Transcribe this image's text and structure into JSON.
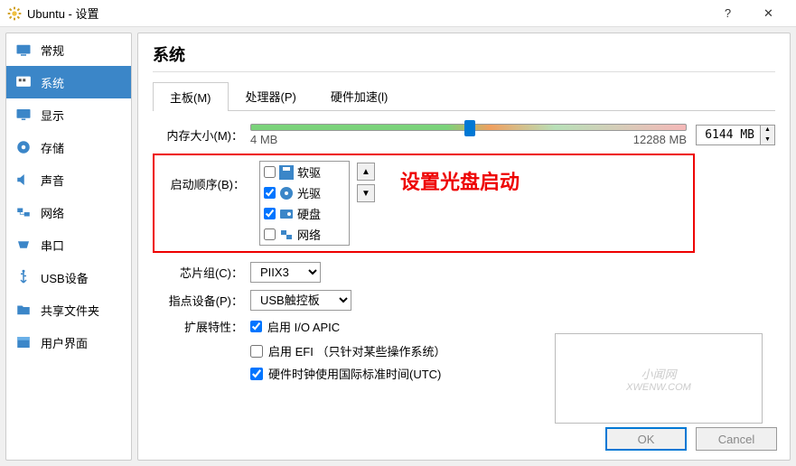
{
  "window": {
    "title": "Ubuntu - 设置",
    "help": "?",
    "close": "✕"
  },
  "sidebar": {
    "items": [
      {
        "label": "常规"
      },
      {
        "label": "系统"
      },
      {
        "label": "显示"
      },
      {
        "label": "存储"
      },
      {
        "label": "声音"
      },
      {
        "label": "网络"
      },
      {
        "label": "串口"
      },
      {
        "label": "USB设备"
      },
      {
        "label": "共享文件夹"
      },
      {
        "label": "用户界面"
      }
    ],
    "selected_index": 1
  },
  "page": {
    "title": "系统"
  },
  "tabs": {
    "items": [
      "主板(M)",
      "处理器(P)",
      "硬件加速(l)"
    ],
    "active_index": 0
  },
  "memory": {
    "label": "内存大小(M)：",
    "min": "4 MB",
    "max": "12288 MB",
    "value": "6144 MB"
  },
  "boot": {
    "label": "启动顺序(B)：",
    "items": [
      {
        "label": "软驱",
        "checked": false,
        "icon": "floppy"
      },
      {
        "label": "光驱",
        "checked": true,
        "icon": "optical"
      },
      {
        "label": "硬盘",
        "checked": true,
        "icon": "disk"
      },
      {
        "label": "网络",
        "checked": false,
        "icon": "network"
      }
    ],
    "annotation": "设置光盘启动"
  },
  "chipset": {
    "label": "芯片组(C)：",
    "value": "PIIX3"
  },
  "pointing": {
    "label": "指点设备(P)：",
    "value": "USB触控板"
  },
  "extended": {
    "label": "扩展特性：",
    "ioapic": {
      "label": "启用 I/O APIC",
      "checked": true
    },
    "efi": {
      "label": "启用 EFI （只针对某些操作系统）",
      "checked": false
    },
    "utc": {
      "label": "硬件时钟使用国际标准时间(UTC)",
      "checked": true
    }
  },
  "buttons": {
    "ok": "OK",
    "cancel": "Cancel"
  },
  "watermark": {
    "big": "小闻网",
    "small": "XWENW.COM"
  }
}
